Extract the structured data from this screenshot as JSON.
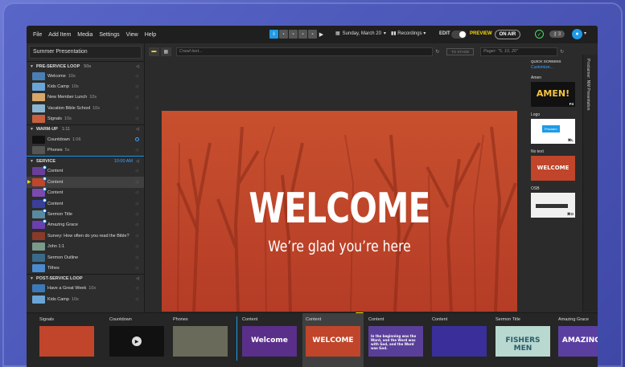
{
  "menu": [
    "File",
    "Add Item",
    "Media",
    "Settings",
    "View",
    "Help"
  ],
  "topbar": {
    "date": "Sunday, March 20",
    "recordings": "Recordings",
    "edit_label": "EDIT",
    "preview_label": "PREVIEW",
    "on_air": "ON AIR",
    "keys_count": "3"
  },
  "presentation_title": "Summer Presentation",
  "sections": [
    {
      "name": "PRE-SERVICE LOOP",
      "duration": "50s",
      "time": "",
      "items": [
        {
          "label": "Welcome",
          "duration": "10s",
          "color": "#4a7fb5"
        },
        {
          "label": "Kids Camp",
          "duration": "10s",
          "color": "#6aa5d8"
        },
        {
          "label": "New Member Lunch",
          "duration": "10s",
          "color": "#d8a86a"
        },
        {
          "label": "Vacation Bible School",
          "duration": "10s",
          "color": "#8ab5d0"
        },
        {
          "label": "Signals",
          "duration": "10s",
          "color": "#c86040"
        }
      ]
    },
    {
      "name": "WARM-UP",
      "duration": "1:11",
      "time": "",
      "items": [
        {
          "label": "Countdown",
          "duration": "1:06",
          "color": "#111111"
        },
        {
          "label": "Phones",
          "duration": "5s",
          "color": "#555555"
        }
      ]
    },
    {
      "name": "SERVICE",
      "duration": "",
      "time": "10:00 AM",
      "items": [
        {
          "label": "Content",
          "duration": "",
          "color": "#6a3f9a"
        },
        {
          "label": "Content",
          "duration": "",
          "color": "#c0452a"
        },
        {
          "label": "Content",
          "duration": "",
          "color": "#7a4ab0"
        },
        {
          "label": "Content",
          "duration": "",
          "color": "#3a3f9a"
        },
        {
          "label": "Sermon Title",
          "duration": "",
          "color": "#5a8aa0"
        },
        {
          "label": "Amazing Grace",
          "duration": "",
          "color": "#6a3fb0"
        },
        {
          "label": "Survey: How often do you read the Bible?",
          "duration": "",
          "color": "#8a3a2a"
        },
        {
          "label": "John 1:1",
          "duration": "",
          "color": "#7a9a8a"
        },
        {
          "label": "Sermon Outline",
          "duration": "",
          "color": "#3a6a8a"
        },
        {
          "label": "Tithes",
          "duration": "",
          "color": "#4a8ad0"
        }
      ]
    },
    {
      "name": "POST-SERVICE LOOP",
      "duration": "",
      "time": "",
      "items": [
        {
          "label": "Have a Great Week",
          "duration": "10s",
          "color": "#3a7ab8"
        },
        {
          "label": "Kids Camp",
          "duration": "10s",
          "color": "#6aa5d8"
        }
      ]
    }
  ],
  "center": {
    "crawl_placeholder": "Crawl text...",
    "to_stage": "TO STAGE",
    "pager_placeholder": "Pager: \"5, 10, 20\"",
    "slide_title": "WELCOME",
    "slide_subtitle": "We’re glad you’re here"
  },
  "quick_screens": {
    "header": "QUICK SCREENS",
    "customize": "Customize...",
    "items": [
      {
        "label": "Amen",
        "key": "F4",
        "bg": "#111111",
        "text": "AMEN!"
      },
      {
        "label": "Logo",
        "key": "⌘L",
        "bg": "#ffffff",
        "text": "Proclaim"
      },
      {
        "label": "No text",
        "key": "",
        "bg": "#c0452a",
        "text": "WELCOME"
      },
      {
        "label": "OSB",
        "key": "⌘O",
        "bg": "#f0f0f0",
        "text": ""
      }
    ]
  },
  "side_tab": "Proclaimer: NW Presentation",
  "bottom_slides": [
    {
      "label": "Signals",
      "bg": "#c0452a"
    },
    {
      "label": "Countdown",
      "bg": "#111111"
    },
    {
      "label": "Phones",
      "bg": "#6a6a5a"
    },
    {
      "label": "Content",
      "bg": "#5a2f8a",
      "text": "Welcome"
    },
    {
      "label": "Content",
      "bg": "#c0452a",
      "text": "WELCOME"
    },
    {
      "label": "Content",
      "bg": "#5a3f9a",
      "text": "In the beginning was the Word, and the Word was with God, and the Word was God."
    },
    {
      "label": "Content",
      "bg": "#3a2f9a",
      "text": ""
    },
    {
      "label": "Sermon Title",
      "bg": "#b8d8d0",
      "text": "FISHERS MEN"
    },
    {
      "label": "Amazing Grace",
      "bg": "#5a3fa0",
      "text": "AMAZING G"
    }
  ],
  "colors": {
    "accent": "#1e9be8",
    "preview": "#f5d90a",
    "slide_bg": "#c0452a"
  }
}
